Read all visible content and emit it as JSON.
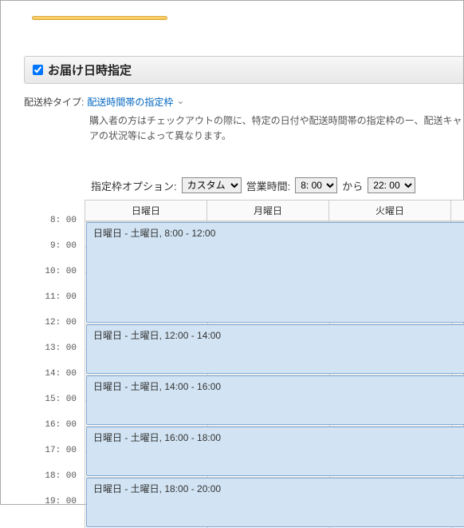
{
  "section": {
    "title": "お届け日時指定"
  },
  "type": {
    "label": "配送枠タイプ:",
    "link": "配送時間帯の指定枠"
  },
  "description": "購入者の方はチェックアウトの際に、特定の日付や配送時間帯の指定枠のー、配送キャリアの状況等によって異なります。",
  "options": {
    "label": "指定枠オプション:",
    "custom": "カスタム",
    "hours_label": "営業時間:",
    "start": "8: 00",
    "between": "から",
    "end": "22: 00"
  },
  "days": {
    "sun": "日曜日",
    "mon": "月曜日",
    "tue": "火曜日"
  },
  "times": {
    "h8": "8: 00",
    "h9": "9: 00",
    "h10": "10: 00",
    "h11": "11: 00",
    "h12": "12: 00",
    "h13": "13: 00",
    "h14": "14: 00",
    "h15": "15: 00",
    "h16": "16: 00",
    "h17": "17: 00",
    "h18": "18: 00",
    "h19": "19: 00"
  },
  "slots": {
    "s1": "日曜日 - 土曜日, 8:00 - 12:00",
    "s2": "日曜日 - 土曜日, 12:00 - 14:00",
    "s3": "日曜日 - 土曜日, 14:00 - 16:00",
    "s4": "日曜日 - 土曜日, 16:00 - 18:00",
    "s5": "日曜日 - 土曜日, 18:00 - 20:00"
  }
}
